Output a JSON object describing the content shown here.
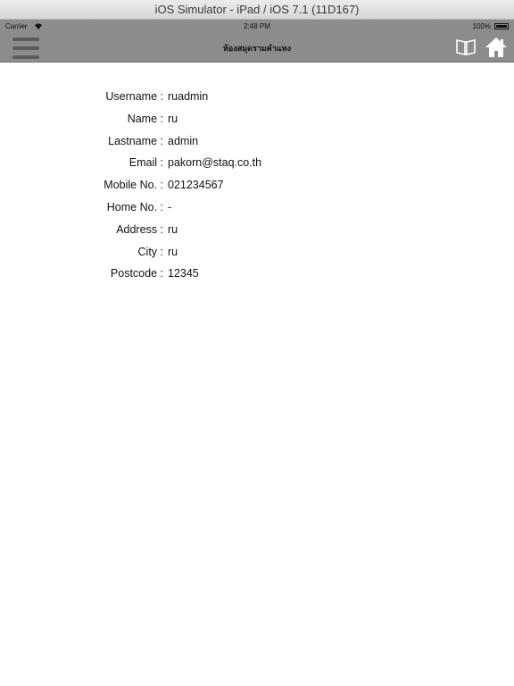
{
  "window": {
    "title": "iOS Simulator - iPad / iOS 7.1 (11D167)"
  },
  "status_bar": {
    "carrier": "Carrier",
    "time": "2:48 PM",
    "battery": "100%"
  },
  "nav_bar": {
    "title": "ห้องสมุดรามคำแหง"
  },
  "profile": {
    "fields": [
      {
        "label": "Username :",
        "value": "ruadmin"
      },
      {
        "label": "Name :",
        "value": "ru"
      },
      {
        "label": "Lastname :",
        "value": "admin"
      },
      {
        "label": "Email :",
        "value": "pakorn@staq.co.th"
      },
      {
        "label": "Mobile No. :",
        "value": "021234567"
      },
      {
        "label": "Home No. :",
        "value": "-"
      },
      {
        "label": "Address :",
        "value": "ru"
      },
      {
        "label": "City :",
        "value": "ru"
      },
      {
        "label": "Postcode :",
        "value": "12345"
      }
    ]
  }
}
